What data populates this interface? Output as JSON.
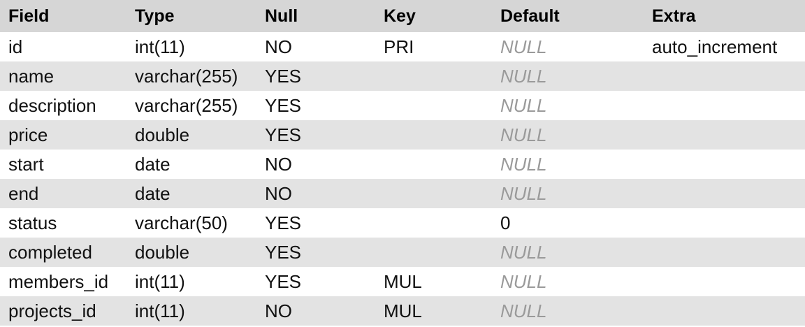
{
  "columns": [
    "Field",
    "Type",
    "Null",
    "Key",
    "Default",
    "Extra"
  ],
  "rows": [
    {
      "field": "id",
      "type": "int(11)",
      "null": "NO",
      "key": "PRI",
      "default": "NULL",
      "extra": "auto_increment"
    },
    {
      "field": "name",
      "type": "varchar(255)",
      "null": "YES",
      "key": "",
      "default": "NULL",
      "extra": ""
    },
    {
      "field": "description",
      "type": "varchar(255)",
      "null": "YES",
      "key": "",
      "default": "NULL",
      "extra": ""
    },
    {
      "field": "price",
      "type": "double",
      "null": "YES",
      "key": "",
      "default": "NULL",
      "extra": ""
    },
    {
      "field": "start",
      "type": "date",
      "null": "NO",
      "key": "",
      "default": "NULL",
      "extra": ""
    },
    {
      "field": "end",
      "type": "date",
      "null": "NO",
      "key": "",
      "default": "NULL",
      "extra": ""
    },
    {
      "field": "status",
      "type": "varchar(50)",
      "null": "YES",
      "key": "",
      "default": "0",
      "extra": ""
    },
    {
      "field": "completed",
      "type": "double",
      "null": "YES",
      "key": "",
      "default": "NULL",
      "extra": ""
    },
    {
      "field": "members_id",
      "type": "int(11)",
      "null": "YES",
      "key": "MUL",
      "default": "NULL",
      "extra": ""
    },
    {
      "field": "projects_id",
      "type": "int(11)",
      "null": "NO",
      "key": "MUL",
      "default": "NULL",
      "extra": ""
    }
  ],
  "colors": {
    "header_bg": "#d6d6d6",
    "row_alt_bg": "#e3e3e3",
    "row_bg": "#ffffff",
    "null_text": "#9a9a9a"
  }
}
